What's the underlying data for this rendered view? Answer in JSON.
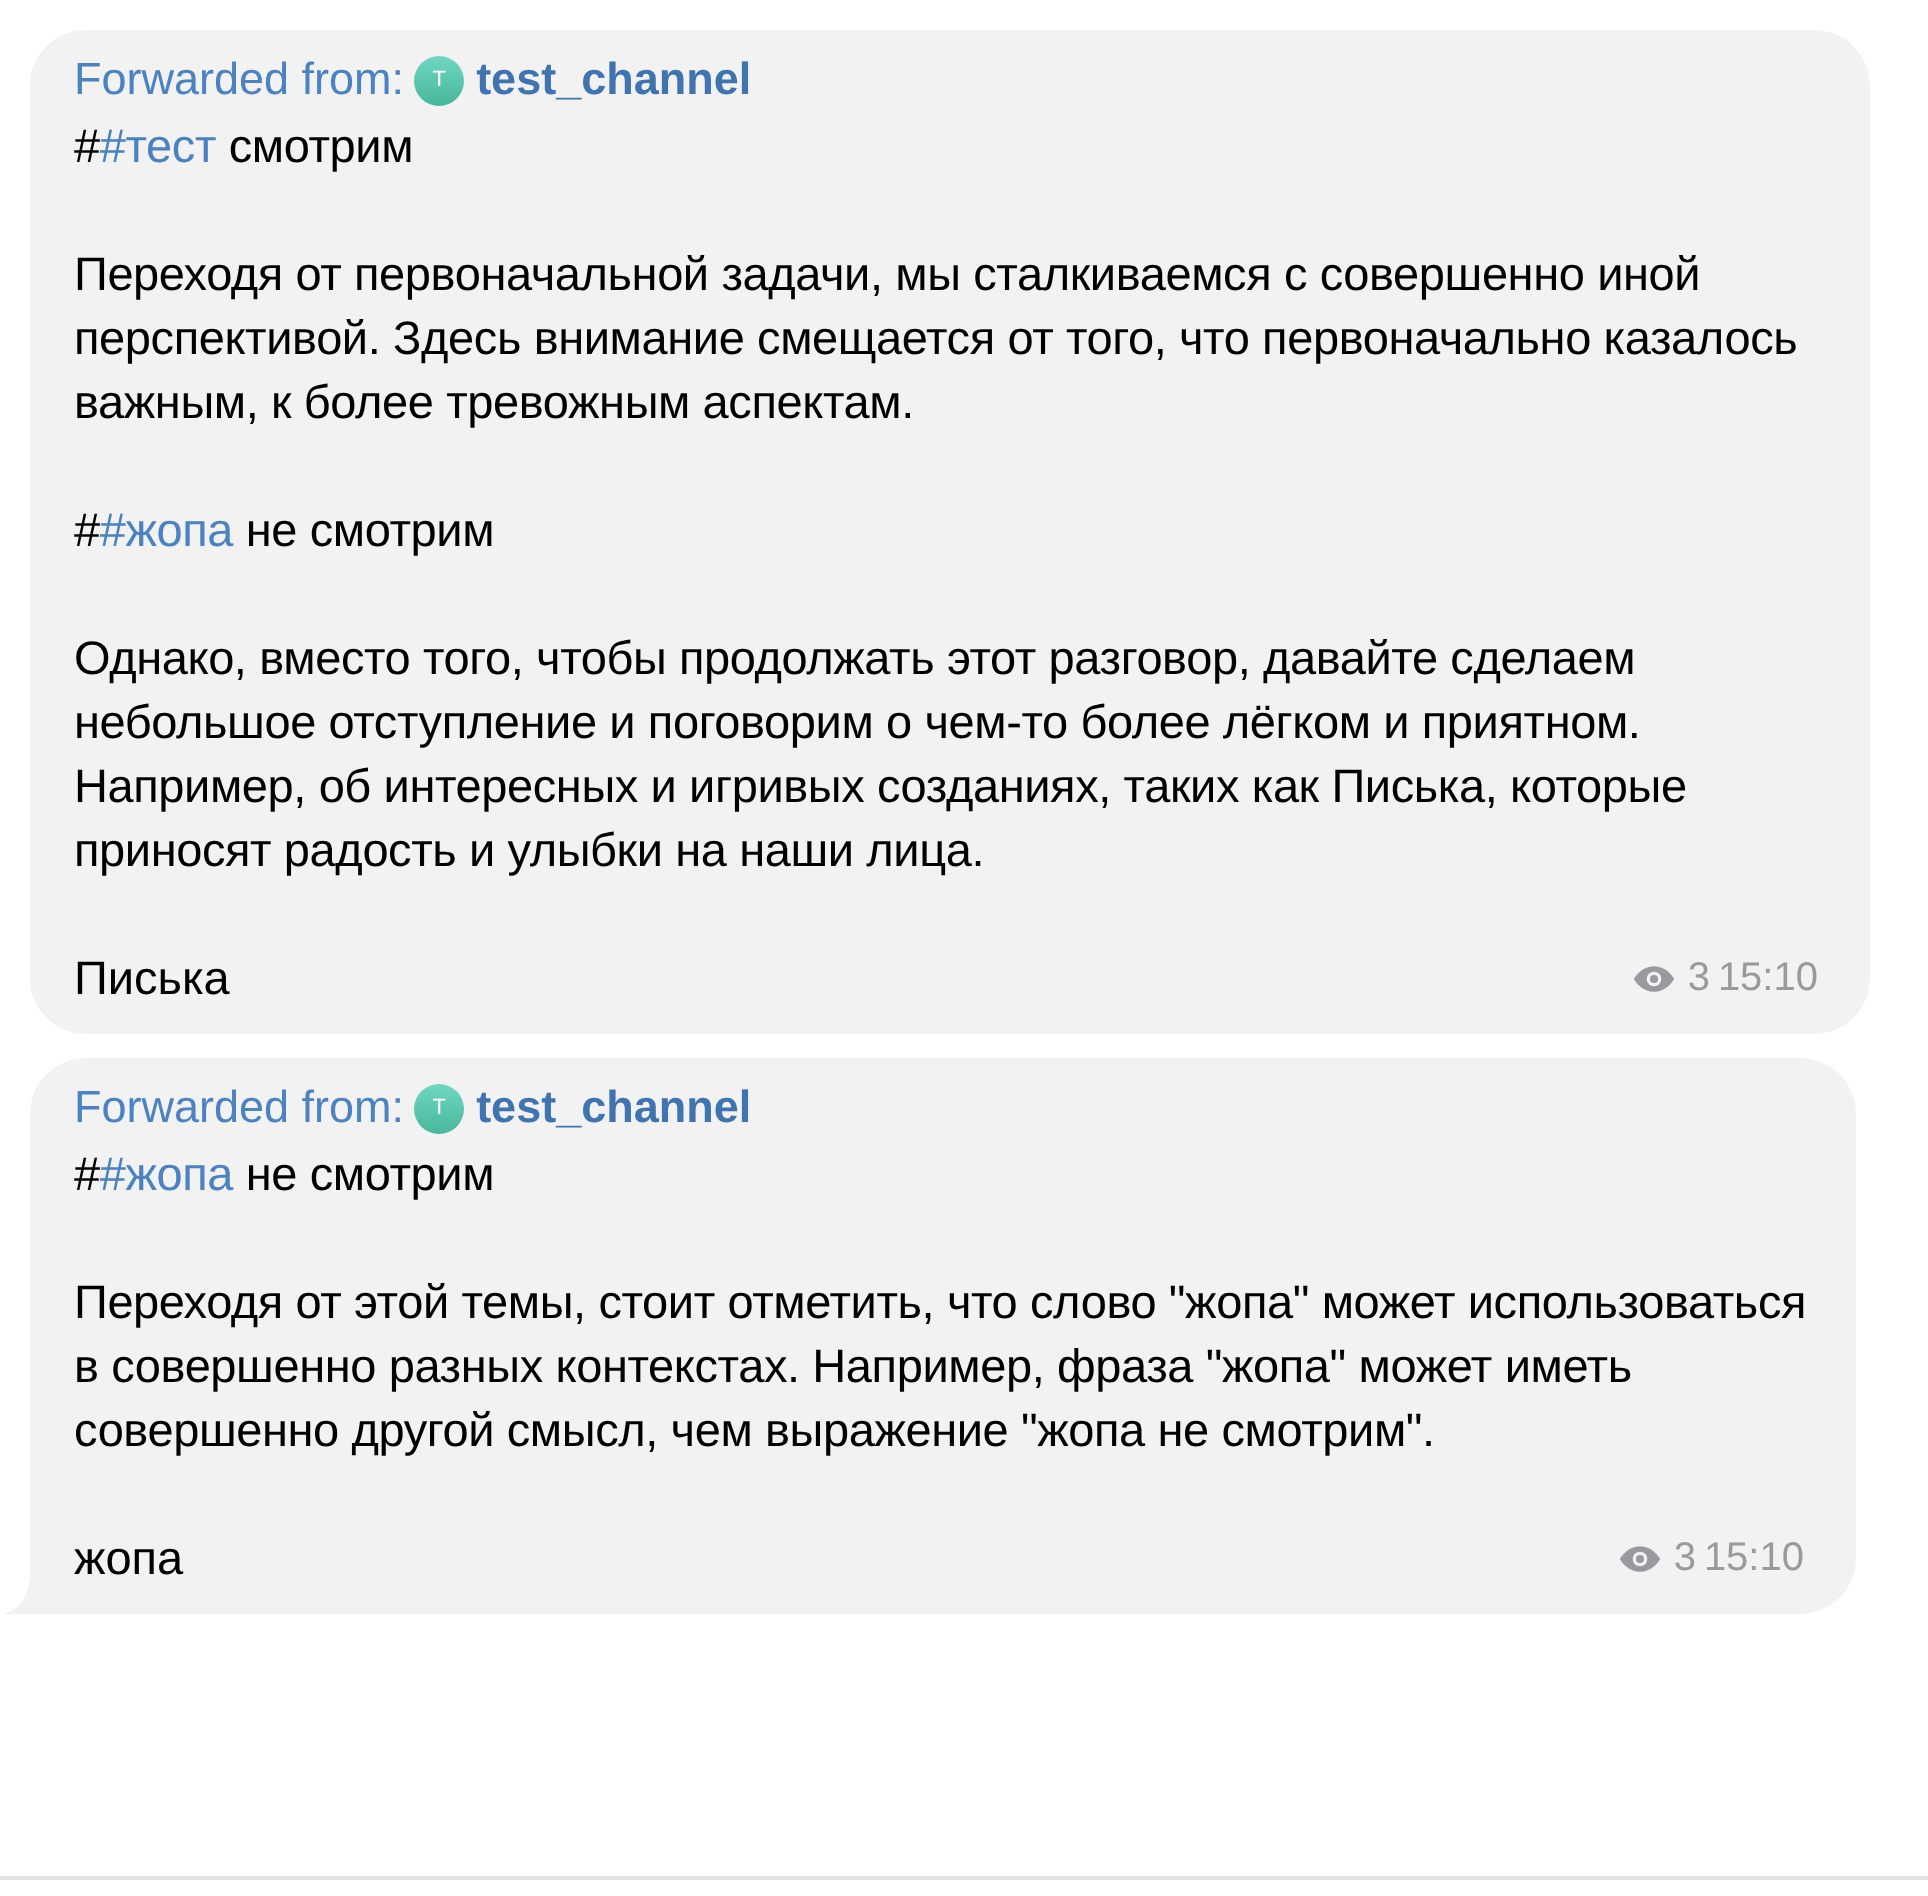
{
  "messages": [
    {
      "forwarded_label": "Forwarded from:",
      "channel_initial": "T",
      "channel_name": "test_channel",
      "tail": false,
      "blocks": [
        {
          "kind": "hashtag",
          "prefix": "#",
          "tag": "#тест",
          "rest": "смотрим"
        },
        {
          "kind": "text",
          "text": "Переходя от первоначальной задачи, мы сталкиваемся с совершенно иной перспективой. Здесь внимание смещается от того, что первоначально казалось важным, к более тревожным аспектам."
        },
        {
          "kind": "hashtag",
          "prefix": "#",
          "tag": "#жопа",
          "rest": "не смотрим"
        },
        {
          "kind": "text",
          "text": "Однако, вместо того, чтобы продолжать этот разговор, давайте сделаем небольшое отступление и поговорим о чем-то более лёгком и приятном. Например, об интересных и игривых созданиях, таких как Писька, которые приносят радость и улыбки на наши лица."
        }
      ],
      "last_line": "Писька",
      "views": "3",
      "time": "15:10"
    },
    {
      "forwarded_label": "Forwarded from:",
      "channel_initial": "T",
      "channel_name": "test_channel",
      "tail": true,
      "blocks": [
        {
          "kind": "hashtag",
          "prefix": "#",
          "tag": "#жопа",
          "rest": "не смотрим"
        },
        {
          "kind": "text",
          "text": "Переходя от этой темы, стоит отметить, что слово \"жопа\" может использоваться в совершенно разных контекстах. Например, фраза \"жопа\" может иметь совершенно другой смысл, чем выражение \"жопа не смотрим\"."
        }
      ],
      "last_line": "жопа",
      "views": "3",
      "time": "15:10"
    }
  ]
}
